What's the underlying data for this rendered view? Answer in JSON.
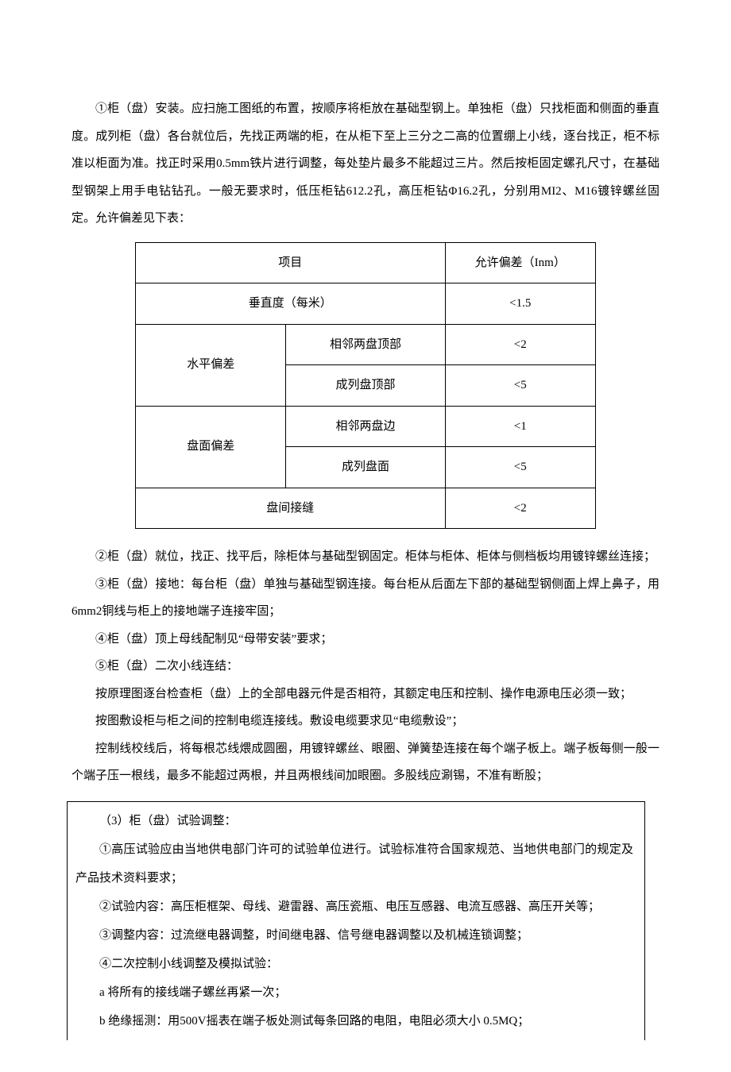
{
  "p1": "①柜（盘）安装。应扫施工图纸的布置，按顺序将柜放在基础型钢上。单独柜（盘）只找柜面和侧面的垂直度。成列柜（盘）各台就位后，先找正两端的柜，在从柜下至上三分之二高的位置绷上小线，逐台找正，柜不标准以柜面为准。找正时采用0.5mm铁片进行调整，每处垫片最多不能超过三片。然后按柜固定螺孔尺寸，在基础型钢架上用手电钻钻孔。一般无要求时，低压柜钻612.2孔，高压柜钻Φ16.2孔，分别用MI2、M16镀锌螺丝固定。允许偏差见下表：",
  "table": {
    "header": {
      "item": "项目",
      "tolerance": "允许偏差（Inm）"
    },
    "rows": [
      {
        "item": "垂直度（每米）",
        "sub": "",
        "val": "<1.5"
      },
      {
        "item": "水平偏差",
        "sub1": "相邻两盘顶部",
        "val1": "<2",
        "sub2": "成列盘顶部",
        "val2": "<5"
      },
      {
        "item": "盘面偏差",
        "sub1": "相邻两盘边",
        "val1": "<1",
        "sub2": "成列盘面",
        "val2": "<5"
      },
      {
        "item": "盘间接缝",
        "sub": "",
        "val": "<2"
      }
    ]
  },
  "p2": "②柜（盘）就位，找正、找平后，除柜体与基础型钢固定。柜体与柜体、柜体与侧档板均用镀锌螺丝连接；",
  "p3": "③柜（盘）接地：每台柜（盘）单独与基础型钢连接。每台柜从后面左下部的基础型钢侧面上焊上鼻子，用6mm2铜线与柜上的接地端子连接牢固；",
  "p4": "④柜（盘）顶上母线配制见“母带安装”要求；",
  "p5": "⑤柜（盘）二次小线连结：",
  "p6": "按原理图逐台检查柜（盘）上的全部电器元件是否相符，其额定电压和控制、操作电源电压必须一致；",
  "p7": "按图敷设柜与柜之间的控制电缆连接线。敷设电缆要求见“电缆敷设”；",
  "p8": "控制线校线后，将每根芯线煨成圆圈，用镀锌螺丝、眼圈、弹簧垫连接在每个端子板上。端子板每侧一般一个端子压一根线，最多不能超过两根，并且两根线间加眼圈。多股线应涮锡，不准有断股；",
  "b1": "（3）柜（盘）试验调整：",
  "b2": "①高压试验应由当地供电部门许可的试验单位进行。试验标准符合国家规范、当地供电部门的规定及产品技术资料要求；",
  "b3": "②试验内容：高压柜框架、母线、避雷器、高压瓷瓶、电压互感器、电流互感器、高压开关等；",
  "b4": "③调整内容：过流继电器调整，时间继电器、信号继电器调整以及机械连锁调整；",
  "b5": "④二次控制小线调整及模拟试验：",
  "b6": "a 将所有的接线端子螺丝再紧一次；",
  "b7": "b 绝缘摇测：用500V摇表在端子板处测试每条回路的电阻，电阻必须大小 0.5MQ；"
}
